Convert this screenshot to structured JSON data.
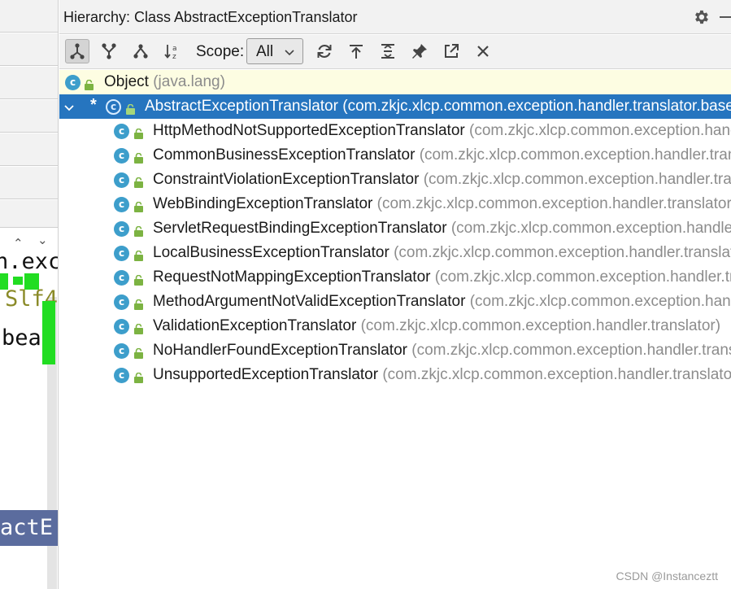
{
  "editor": {
    "code_line_1": "n.exc",
    "code_line_2": "Slf4",
    "code_line_3": "bean",
    "selected_word": "actE"
  },
  "panel": {
    "title": "Hierarchy:  Class AbstractExceptionTranslator",
    "scope_label": "Scope:",
    "scope_value": "All",
    "icons": {
      "settings": "gear-icon",
      "minimize": "minimize-icon",
      "subtypes": "subtypes-hierarchy-icon",
      "supertypes": "supertypes-hierarchy-icon",
      "class_hierarchy": "class-hierarchy-icon",
      "sort": "sort-alphabetically-icon",
      "refresh": "refresh-icon",
      "export": "export-icon",
      "expand_all": "expand-all-icon",
      "pin": "pin-icon",
      "open_editor": "open-in-editor-icon",
      "close": "close-icon"
    }
  },
  "tree": {
    "root": {
      "name": "Object",
      "package": "(java.lang)"
    },
    "selected": {
      "marker": "*",
      "name": "AbstractExceptionTranslator",
      "package": "(com.zkjc.xlcp.common.exception.handler.translator.base)"
    },
    "children": [
      {
        "name": "HttpMethodNotSupportedExceptionTranslator",
        "package": "(com.zkjc.xlcp.common.exception.handler.translator)"
      },
      {
        "name": "CommonBusinessExceptionTranslator",
        "package": "(com.zkjc.xlcp.common.exception.handler.translator)"
      },
      {
        "name": "ConstraintViolationExceptionTranslator",
        "package": "(com.zkjc.xlcp.common.exception.handler.translator)"
      },
      {
        "name": "WebBindingExceptionTranslator",
        "package": "(com.zkjc.xlcp.common.exception.handler.translator)"
      },
      {
        "name": "ServletRequestBindingExceptionTranslator",
        "package": "(com.zkjc.xlcp.common.exception.handler.translator)"
      },
      {
        "name": "LocalBusinessExceptionTranslator",
        "package": "(com.zkjc.xlcp.common.exception.handler.translator)"
      },
      {
        "name": "RequestNotMappingExceptionTranslator",
        "package": "(com.zkjc.xlcp.common.exception.handler.translator)"
      },
      {
        "name": "MethodArgumentNotValidExceptionTranslator",
        "package": "(com.zkjc.xlcp.common.exception.handler.translator)"
      },
      {
        "name": "ValidationExceptionTranslator",
        "package": "(com.zkjc.xlcp.common.exception.handler.translator)"
      },
      {
        "name": "NoHandlerFoundExceptionTranslator",
        "package": "(com.zkjc.xlcp.common.exception.handler.translator)"
      },
      {
        "name": "UnsupportedExceptionTranslator",
        "package": "(com.zkjc.xlcp.common.exception.handler.translator)"
      }
    ]
  },
  "watermark": "CSDN @Instanceztt",
  "colors": {
    "selection": "#2675bf",
    "root_highlight": "#fdfde2",
    "class_icon": "#3d9ecb",
    "lock_icon": "#7cb342",
    "package_text": "#8c8c8c"
  }
}
